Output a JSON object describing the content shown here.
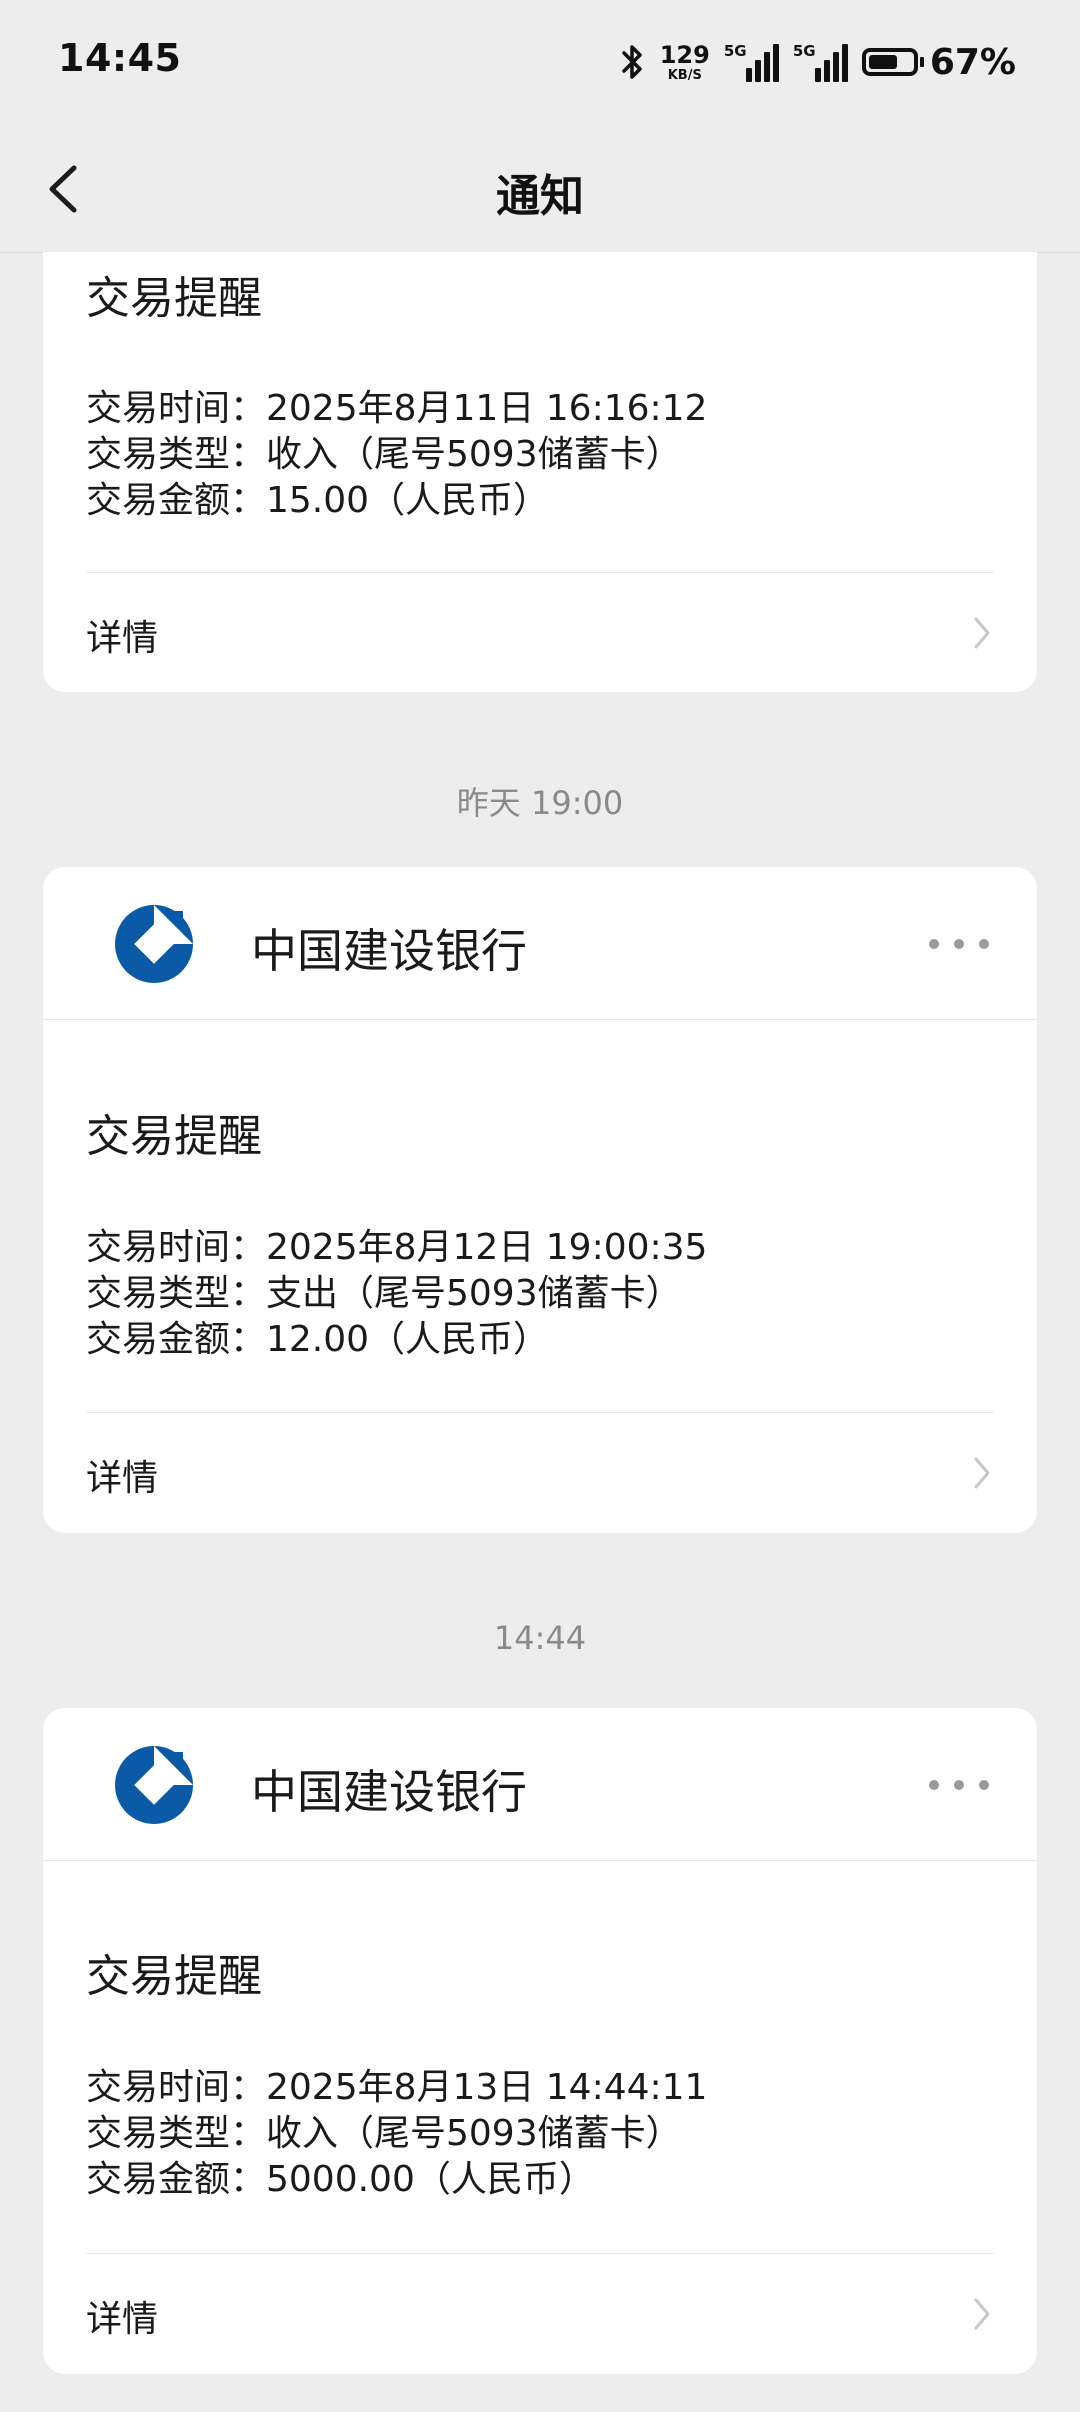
{
  "status_bar": {
    "time": "14:45",
    "net_speed_value": "129",
    "net_speed_unit": "KB/S",
    "signal_1_label": "5G",
    "signal_2_label": "5G",
    "battery_percent": "67%",
    "battery_level": 0.67
  },
  "nav": {
    "title": "通知"
  },
  "cards": [
    {
      "title": "交易提醒",
      "lines": [
        "交易时间：2025年8月11日 16:16:12",
        "交易类型：收入（尾号5093储蓄卡）",
        "交易金额：15.00（人民币）"
      ],
      "detail_label": "详情"
    },
    {
      "time_separator": "昨天 19:00",
      "bank_name": "中国建设银行",
      "title": "交易提醒",
      "lines": [
        "交易时间：2025年8月12日 19:00:35",
        "交易类型：支出（尾号5093储蓄卡）",
        "交易金额：12.00（人民币）"
      ],
      "detail_label": "详情"
    },
    {
      "time_separator": "14:44",
      "bank_name": "中国建设银行",
      "title": "交易提醒",
      "lines": [
        "交易时间：2025年8月13日 14:44:11",
        "交易类型：收入（尾号5093储蓄卡）",
        "交易金额：5000.00（人民币）"
      ],
      "detail_label": "详情"
    }
  ],
  "colors": {
    "brand_blue": "#0a5aa8",
    "background": "#ededed",
    "card": "#ffffff"
  }
}
